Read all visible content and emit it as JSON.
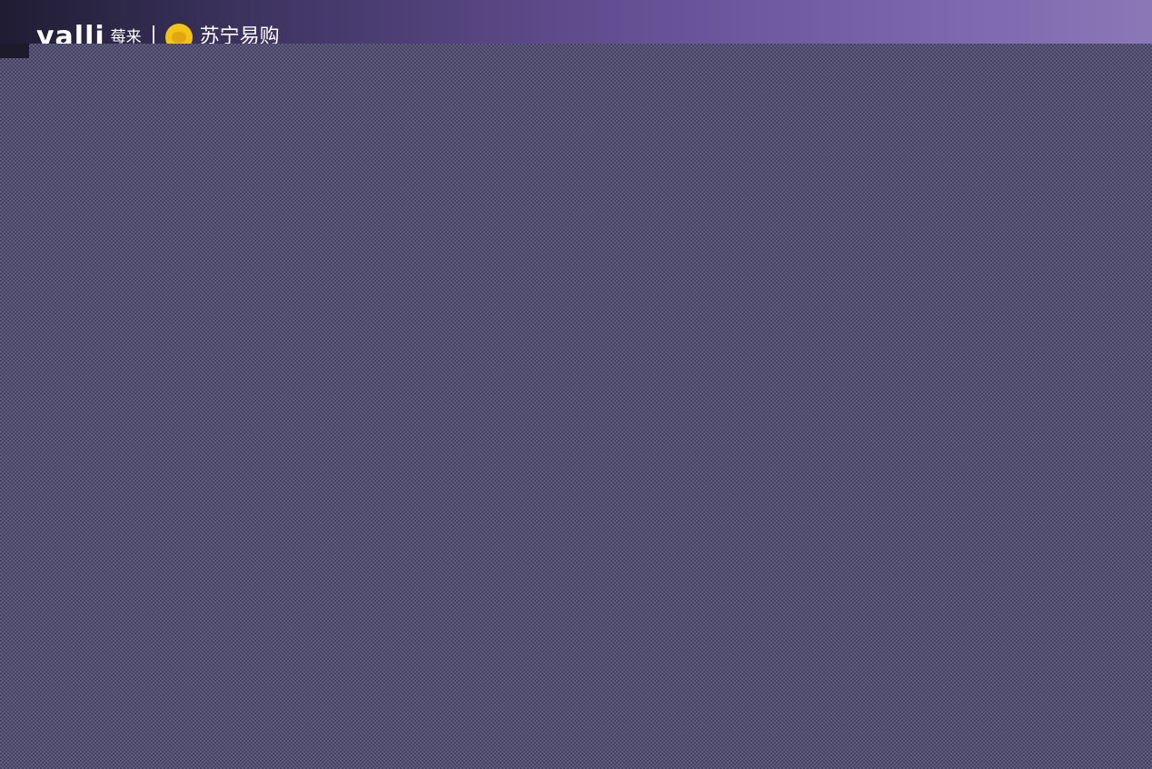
{
  "brand": {
    "wordmark": "yalli",
    "suffix": "莓来",
    "partner_icon": "duck-logo-icon",
    "partner_name": "苏宁易购"
  },
  "colors": {
    "banner_start": "#1f1c33",
    "banner_end": "#8a78b6",
    "overlay": "#525073",
    "partner_icon": "#f3c417"
  }
}
